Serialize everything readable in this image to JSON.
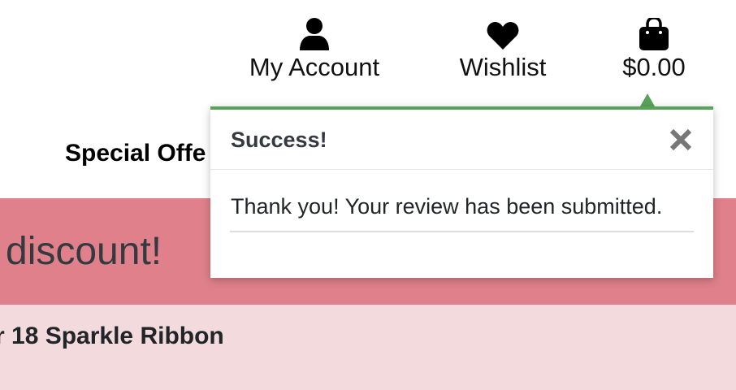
{
  "header": {
    "account": {
      "label": "My Account",
      "icon": "user-icon"
    },
    "wishlist": {
      "label": "Wishlist",
      "icon": "heart-icon"
    },
    "bag": {
      "total": "$0.00",
      "icon": "shopping-bag-icon"
    }
  },
  "nav": {
    "special_offers": "Special Offe"
  },
  "banner": {
    "text": "discount!",
    "color": "#e0808a"
  },
  "product": {
    "title": "r 18 Sparkle Ribbon"
  },
  "toast": {
    "title": "Success!",
    "message": "Thank you! Your review has been submitted.",
    "close_icon": "close-icon",
    "accent_color": "#5aa35a"
  }
}
